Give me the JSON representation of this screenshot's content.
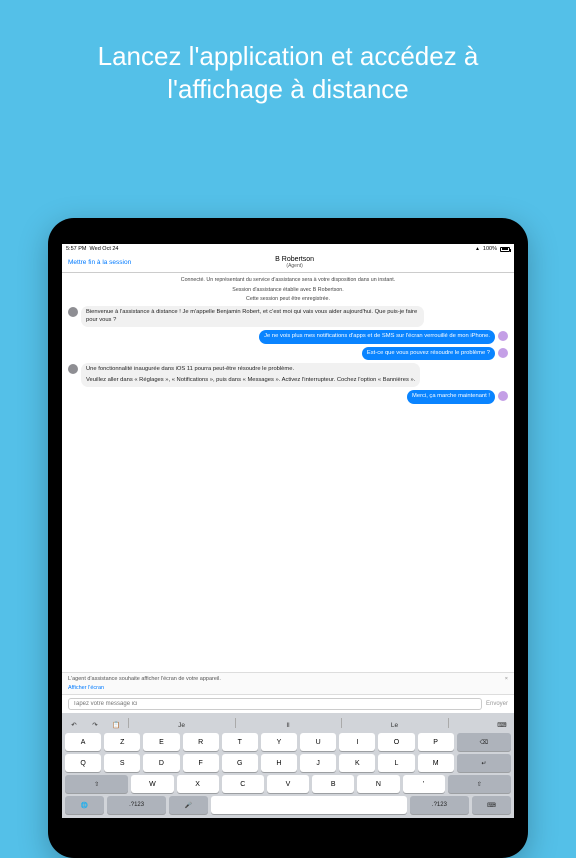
{
  "headline": "Lancez l'application et accédez à l'affichage à distance",
  "statusbar": {
    "time": "5:57 PM",
    "date": "Wed Oct 24",
    "battery": "100%"
  },
  "nav": {
    "end_session": "Mettre fin à la session",
    "agent_name": "B Robertson",
    "agent_role": "(Agent)"
  },
  "system_msgs": {
    "connected": "Connecté. Un représentant du service d'assistance sera à votre disposition dans un instant.",
    "established": "Session d'assistance établie avec B Robertson.",
    "recorded": "Cette session peut être enregistrée."
  },
  "messages": {
    "agent1": "Bienvenue à l'assistance à distance ! Je m'appelle Benjamin Robert, et c'est moi qui vais vous aider aujourd'hui. Que puis-je faire pour vous ?",
    "user1": "Je ne vois plus mes notifications d'apps et de SMS sur l'écran verrouillé de mon iPhone.",
    "user2": "Est-ce que vous pouvez résoudre le problème ?",
    "agent2a": "Une fonctionnalité inaugurée dans iOS 11 pourra peut-être résoudre le problème.",
    "agent2b": "Veuillez aller dans « Réglages », « Notifications », puis dans « Messages ». Activez l'interrupteur. Cochez l'option « Bannières ».",
    "user3": "Merci, ça marche maintenant !"
  },
  "prompt": {
    "text": "L'agent d'assistance souhaite afficher l'écran de votre appareil.",
    "link": "Afficher l'écran",
    "close": "×"
  },
  "input": {
    "placeholder": "Tapez votre message ici",
    "send": "Envoyer"
  },
  "keyboard": {
    "suggestions": [
      "Je",
      "Il",
      "Le"
    ],
    "row1": [
      "A",
      "Z",
      "E",
      "R",
      "T",
      "Y",
      "U",
      "I",
      "O",
      "P"
    ],
    "row2": [
      "Q",
      "S",
      "D",
      "F",
      "G",
      "H",
      "J",
      "K",
      "L",
      "M"
    ],
    "row3_shift": "⇧",
    "row3": [
      "W",
      "X",
      "C",
      "V",
      "B",
      "N"
    ],
    "row3_punct": [
      "'",
      "←"
    ],
    "bottom": {
      "globe": "🌐",
      "numkey": ".?123",
      "mic": "🎤",
      "hide": "⌨",
      "return_label": "↵",
      "undo1": "↶",
      "undo2": "↷",
      "clipboard": "📋"
    }
  }
}
